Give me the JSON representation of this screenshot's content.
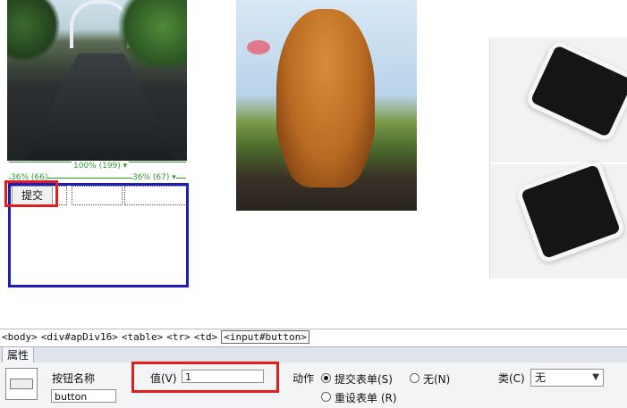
{
  "canvas": {
    "guides": {
      "top_width": "100% (199)",
      "left_width": "36% (66)",
      "right_width": "36% (67)"
    },
    "submit_label": "提交"
  },
  "tag_selector": {
    "tags": [
      "<body>",
      "<div#apDiv16>",
      "<table>",
      "<tr>",
      "<td>"
    ],
    "selected": "<input#button>"
  },
  "properties": {
    "tab_label": "属性",
    "button_name_label": "按钮名称",
    "button_name_value": "button",
    "value_label": "值(V)",
    "value_value": "1",
    "action_label": "动作",
    "action_submit": "提交表单(S)",
    "action_none": "无(N)",
    "action_reset": "重设表单 (R)",
    "class_label": "类(C)",
    "class_value": "无",
    "action_selected": "submit"
  },
  "colors": {
    "highlight_red": "#e01e1e",
    "layer_blue": "#1d1db8",
    "guide_green": "#2e9a2e"
  }
}
